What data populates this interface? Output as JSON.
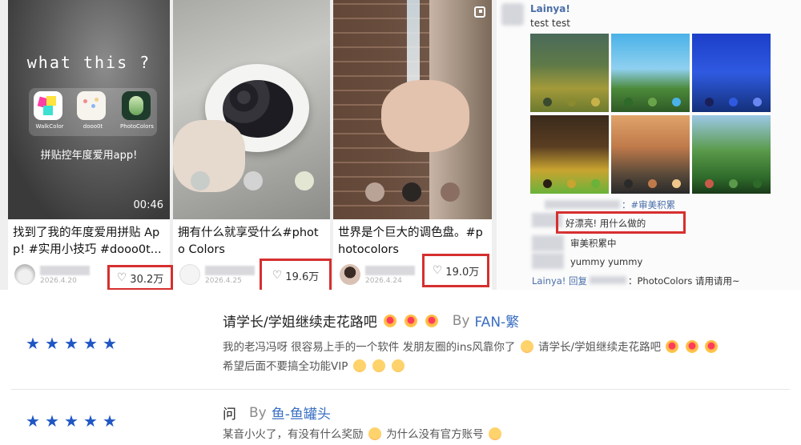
{
  "cards": [
    {
      "overlay_title": "what this ?",
      "apps": [
        "WalkColor",
        "dooo0t",
        "PhotoColors"
      ],
      "overlay_sub": "拼贴控年度爱用app!",
      "duration": "00:46",
      "caption": "找到了我的年度爱用拼贴 App! #实用小技巧 #dooo0t...",
      "date": "2026.4.20",
      "likes": "30.2万"
    },
    {
      "caption": "拥有什么就享受什么#photo Colors",
      "date": "2026.4.25",
      "likes": "19.6万"
    },
    {
      "caption": "世界是个巨大的调色盘。#p hotocolors",
      "date": "2026.4.24",
      "likes": "19.0万"
    }
  ],
  "chat": {
    "user": "Lainya!",
    "message": "test test",
    "tag_line": "：#审美积累",
    "highlight_comment": "好漂亮! 用什么做的",
    "reply1": "审美积累中",
    "reply2": "yummy yummy",
    "reply_prefix": "Lainya! 回复",
    "reply_suffix": "：PhotoColors 请用请用~"
  },
  "reviews": [
    {
      "rating": 5,
      "title": "请学长/学姐继续走花路吧",
      "by": "By",
      "author": "FAN-繁",
      "line1": "我的老冯冯呀 很容易上手的一个软件 发朋友圈的ins风靠你了",
      "line1b": "请学长/学姐继续走花路吧",
      "line2": "希望后面不要搞全功能VIP"
    },
    {
      "rating": 5,
      "title": "问",
      "by": "By",
      "author": "鱼-鱼罐头",
      "line1": "某音小火了，有没有什么奖励",
      "line1b": "为什么没有官方账号"
    }
  ],
  "colors": {
    "highlight": "#d62f2f",
    "star": "#1f56c4",
    "author": "#3a6fc2"
  }
}
